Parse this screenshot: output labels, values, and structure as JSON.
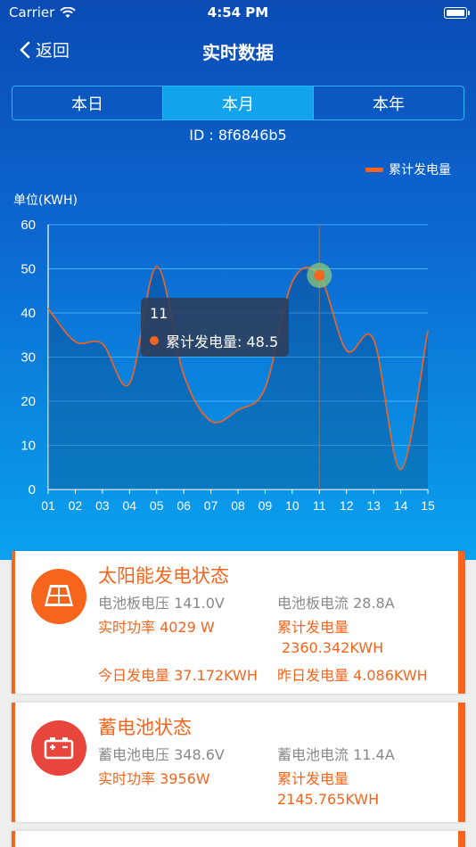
{
  "status": {
    "carrier": "Carrier",
    "time": "4:54 PM"
  },
  "nav": {
    "back_label": "返回",
    "title": "实时数据"
  },
  "tabs": [
    {
      "label": "本日",
      "active": false
    },
    {
      "label": "本月",
      "active": true
    },
    {
      "label": "本年",
      "active": false
    }
  ],
  "device_id": "ID : 8f6846b5",
  "colors": {
    "accent": "#f7641c",
    "header_blue": "#0c66cf",
    "active_tab": "#12a3ec"
  },
  "chart_data": {
    "type": "line",
    "ylabel": "单位(KWH)",
    "legend": "累计发电量",
    "legend_position": "top-right",
    "categories": [
      "01",
      "02",
      "03",
      "04",
      "05",
      "06",
      "07",
      "08",
      "09",
      "10",
      "11",
      "12",
      "13",
      "14",
      "15"
    ],
    "ylim": [
      0,
      60
    ],
    "yticks": [
      0,
      10,
      20,
      30,
      40,
      50,
      60
    ],
    "grid": true,
    "series": [
      {
        "name": "累计发电量",
        "values": [
          41,
          33.5,
          33,
          24,
          50.5,
          26,
          15.5,
          18,
          23,
          47,
          48.5,
          31.5,
          34,
          4.5,
          36
        ]
      }
    ],
    "highlight": {
      "category": "11",
      "label": "累计发电量",
      "value": "48.5"
    }
  },
  "cards": [
    {
      "title": "太阳能发电状态",
      "icon": "solar-panel-icon",
      "icon_color": "#f7641c",
      "fields": {
        "panel_voltage": "电池板电压 141.0V",
        "panel_current": "电池板电流 28.8A",
        "power": "实时功率  4029 W",
        "total_label": "累计发电量",
        "total_value": "2360.342KWH",
        "today": "今日发电量 37.172KWH",
        "yesterday": "昨日发电量 4.086KWH"
      }
    },
    {
      "title": "蓄电池状态",
      "icon": "battery-icon",
      "icon_color": "#e8453c",
      "fields": {
        "battery_voltage": "蓄电池电压 348.6V",
        "battery_current": "蓄电池电流 11.4A",
        "power": "实时功率   3956W",
        "total_label": "累计发电量",
        "total_value": "2145.765KWH"
      }
    }
  ]
}
